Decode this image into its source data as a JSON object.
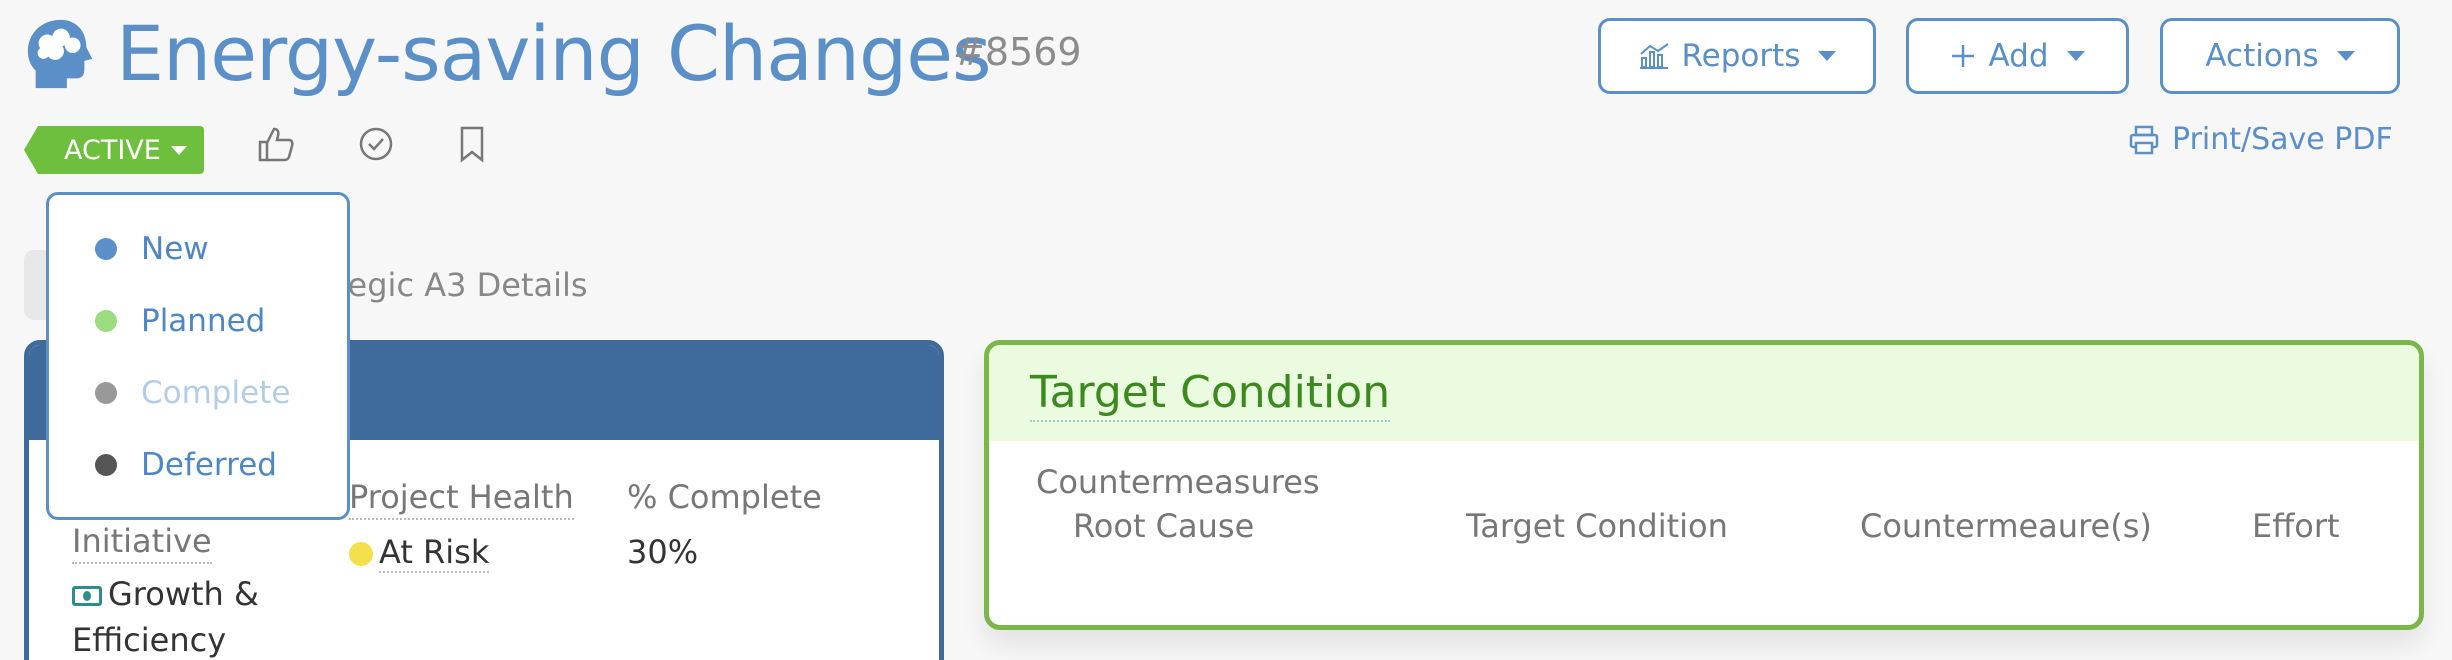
{
  "header": {
    "title": "Energy-saving Changes",
    "ticket_id": "#8569",
    "buttons": {
      "reports": "Reports",
      "add": "Add",
      "actions": "Actions"
    }
  },
  "status_row": {
    "status": "ACTIVE",
    "print_label": "Print/Save PDF",
    "icons": [
      "thumbs-up-icon",
      "check-circle-icon",
      "bookmark-icon"
    ]
  },
  "tabs": {
    "visible_text": "tegic A3 Details"
  },
  "status_dropdown": {
    "items": [
      {
        "label": "New",
        "color": "#5b8fc7"
      },
      {
        "label": "Planned",
        "color": "#9ddb80"
      },
      {
        "label": "Complete",
        "color": "#999999"
      },
      {
        "label": "Deferred",
        "color": "#555555"
      }
    ]
  },
  "left_card": {
    "initiative_label": "Initiative",
    "initiative_value_line1": "Growth &",
    "initiative_value_line2": "Efficiency",
    "health_label": "Project Health",
    "health_value": "At Risk",
    "health_color": "#f4e04d",
    "complete_label": "% Complete",
    "complete_value": "30%"
  },
  "right_card": {
    "title": "Target Condition",
    "subtitle": "Countermeasures",
    "columns": [
      "Root Cause",
      "Target Condition",
      "Countermeaure(s)",
      "Effort"
    ]
  },
  "colors": {
    "brand_blue": "#5b8fc7",
    "status_green": "#6fbf3f",
    "card_blue": "#3e6b9b",
    "card_green": "#7ab648"
  }
}
